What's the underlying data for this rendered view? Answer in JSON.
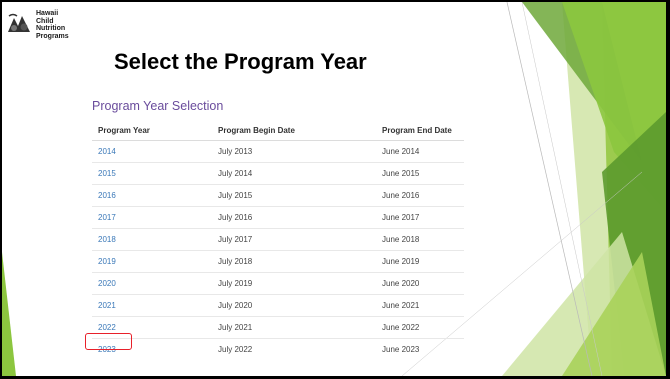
{
  "logo": {
    "lines": [
      "Hawaii",
      "Child",
      "Nutrition",
      "Programs"
    ]
  },
  "slide": {
    "title": "Select the Program Year"
  },
  "selection": {
    "heading": "Program Year Selection",
    "columns": [
      "Program Year",
      "Program Begin Date",
      "Program End Date"
    ],
    "rows": [
      {
        "year": "2014",
        "begin": "July 2013",
        "end": "June 2014"
      },
      {
        "year": "2015",
        "begin": "July 2014",
        "end": "June 2015"
      },
      {
        "year": "2016",
        "begin": "July 2015",
        "end": "June 2016"
      },
      {
        "year": "2017",
        "begin": "July 2016",
        "end": "June 2017"
      },
      {
        "year": "2018",
        "begin": "July 2017",
        "end": "June 2018"
      },
      {
        "year": "2019",
        "begin": "July 2018",
        "end": "June 2019"
      },
      {
        "year": "2020",
        "begin": "July 2019",
        "end": "June 2020"
      },
      {
        "year": "2021",
        "begin": "July 2020",
        "end": "June 2021"
      },
      {
        "year": "2022",
        "begin": "July 2021",
        "end": "June 2022"
      },
      {
        "year": "2023",
        "begin": "July 2022",
        "end": "June 2023"
      }
    ],
    "highlighted_year": "2023"
  },
  "colors": {
    "heading": "#6a4c9c",
    "year_link": "#3a78b8",
    "highlight_border": "#e8202a",
    "accent_green": "#8cc63f",
    "accent_dark_green": "#5c9a2e"
  }
}
